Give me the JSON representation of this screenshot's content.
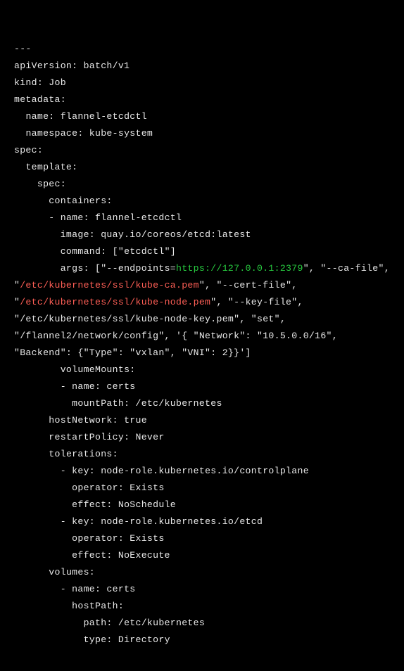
{
  "code": {
    "t01": "---",
    "t02": "apiVersion: batch/v1",
    "t03": "kind: Job",
    "t04": "metadata:",
    "t05": "  name: flannel-etcdctl",
    "t06": "  namespace: kube-system",
    "t07": "spec:",
    "t08": "  template:",
    "t09": "    spec:",
    "t10": "      containers:",
    "t11": "      - name: flannel-etcdctl",
    "t12": "        image: quay.io/coreos/etcd:latest",
    "t13": "        command: [\"etcdctl\"]",
    "t14a": "        args: [\"--endpoints=",
    "t14b": "https://127.0.0.1:2379",
    "t14c": "\", \"--ca-file\", \"",
    "t14d": "/etc/kubernetes/ssl/kube-ca.pem",
    "t14e": "\", \"--cert-file\", \"",
    "t14f": "/etc/kubernetes/ssl/kube-node.pem",
    "t14g": "\", \"--key-file\", \"/etc/kubernetes/ssl/kube-node-key.pem\", \"set\", \"/flannel2/network/config\", '{ \"Network\": \"10.5.0.0/16\", \"Backend\": {\"Type\": \"vxlan\", \"VNI\": 2}}']",
    "t15": "        volumeMounts:",
    "t16": "        - name: certs",
    "t17": "          mountPath: /etc/kubernetes",
    "t18": "      hostNetwork: true",
    "t19": "      restartPolicy: Never",
    "t20": "      tolerations:",
    "t21": "        - key: node-role.kubernetes.io/controlplane",
    "t22": "          operator: Exists",
    "t23": "          effect: NoSchedule",
    "t24": "        - key: node-role.kubernetes.io/etcd",
    "t25": "          operator: Exists",
    "t26": "          effect: NoExecute",
    "t27": "      volumes:",
    "t28": "        - name: certs",
    "t29": "          hostPath:",
    "t30": "            path: /etc/kubernetes",
    "t31": "            type: Directory"
  }
}
